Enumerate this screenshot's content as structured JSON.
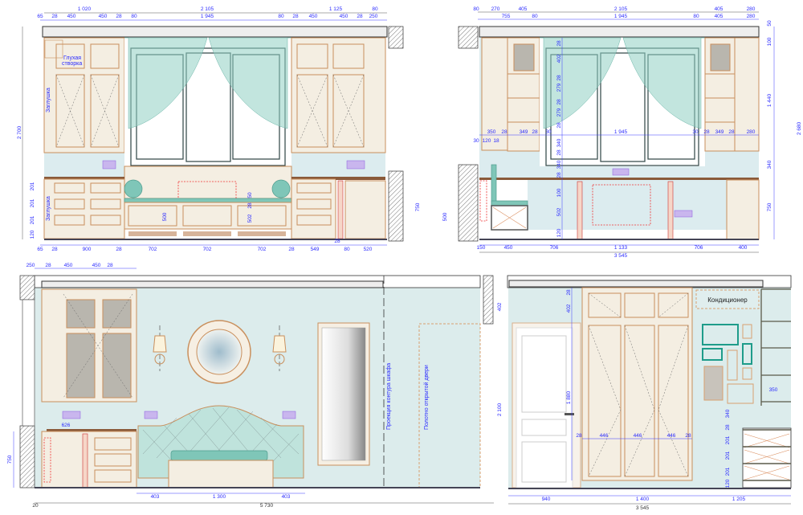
{
  "notes": {
    "blind_sash_1": "Глухая",
    "blind_sash_2": "створка",
    "plug": "Заглушка",
    "wardrobe_projection": "Проекция контура шкафа",
    "open_door_leaf": "Полотно открытой двери",
    "air_conditioner": "Кондиционер"
  },
  "colors": {
    "cabinet": "#f4eee2",
    "cabinet_edge": "#c98f5c",
    "wall": "#dcecec",
    "curtain": "#8fd0c3",
    "dimension": "#2b2bff",
    "frames": "#1e9c8a"
  },
  "elevation_1": {
    "dims": [
      "1 020",
      "2 105",
      "1 125",
      "80",
      "65",
      "28",
      "450",
      "450",
      "28",
      "80",
      "1 945",
      "80",
      "28",
      "450",
      "450",
      "28",
      "250",
      "2 700",
      "201",
      "201",
      "201",
      "120",
      "500",
      "50",
      "28",
      "502",
      "750",
      "65",
      "28",
      "900",
      "28",
      "702",
      "702",
      "702",
      "28",
      "549",
      "28",
      "80",
      "520"
    ]
  },
  "elevation_2": {
    "dims": [
      "80",
      "270",
      "405",
      "2 105",
      "405",
      "280",
      "755",
      "80",
      "1 945",
      "80",
      "405",
      "280",
      "50",
      "100",
      "1 440",
      "2 680",
      "340",
      "750",
      "350",
      "28",
      "349",
      "28",
      "30",
      "1 945",
      "30",
      "28",
      "349",
      "28",
      "280",
      "30",
      "120",
      "18",
      "28",
      "402",
      "28",
      "279",
      "28",
      "279",
      "28",
      "340",
      "28",
      "340",
      "28",
      "100",
      "502",
      "120",
      "500",
      "150",
      "450",
      "706",
      "1 133",
      "706",
      "400",
      "3 545"
    ]
  },
  "elevation_3": {
    "dims": [
      "250",
      "28",
      "450",
      "450",
      "28",
      "626",
      "750",
      "403",
      "1 300",
      "403",
      "20",
      "5 730"
    ]
  },
  "elevation_4": {
    "dims": [
      "402",
      "2 100",
      "28",
      "402",
      "1 880",
      "28",
      "446",
      "446",
      "446",
      "28",
      "350",
      "340",
      "28",
      "201",
      "201",
      "201",
      "120",
      "940",
      "1 400",
      "1 205",
      "3 545"
    ]
  }
}
